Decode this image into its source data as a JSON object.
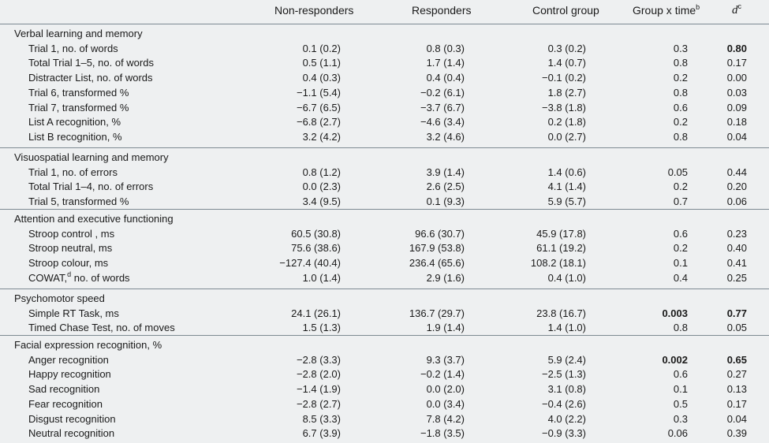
{
  "headers": {
    "c2": "Non-responders",
    "c3": "Responders",
    "c4": "Control group",
    "c5": "Group x time",
    "c5_sup": "b",
    "c6": "d",
    "c6_sup": "c"
  },
  "sections": [
    {
      "title": "Verbal learning and memory",
      "rows": [
        {
          "label": "Trial 1, no. of words",
          "c2": "0.1 (0.2)",
          "c3": "0.8 (0.3)",
          "c4": "0.3 (0.2)",
          "c5": "0.3",
          "c6": "0.80",
          "bold5": false,
          "bold6": true
        },
        {
          "label": "Total Trial 1–5, no. of words",
          "c2": "0.5 (1.1)",
          "c3": "1.7 (1.4)",
          "c4": "1.4 (0.7)",
          "c5": "0.8",
          "c6": "0.17",
          "bold5": false,
          "bold6": false
        },
        {
          "label": "Distracter List, no. of words",
          "c2": "0.4 (0.3)",
          "c3": "0.4 (0.4)",
          "c4": "−0.1 (0.2)",
          "c5": "0.2",
          "c6": "0.00",
          "bold5": false,
          "bold6": false
        },
        {
          "label": "Trial 6, transformed %",
          "c2": "−1.1 (5.4)",
          "c3": "−0.2 (6.1)",
          "c4": "1.8 (2.7)",
          "c5": "0.8",
          "c6": "0.03",
          "bold5": false,
          "bold6": false
        },
        {
          "label": "Trial 7, transformed %",
          "c2": "−6.7 (6.5)",
          "c3": "−3.7 (6.7)",
          "c4": "−3.8 (1.8)",
          "c5": "0.6",
          "c6": "0.09",
          "bold5": false,
          "bold6": false
        },
        {
          "label": "List A recognition, %",
          "c2": "−6.8 (2.7)",
          "c3": "−4.6 (3.4)",
          "c4": "0.2 (1.8)",
          "c5": "0.2",
          "c6": "0.18",
          "bold5": false,
          "bold6": false
        },
        {
          "label": "List B recognition, %",
          "c2": "3.2 (4.2)",
          "c3": "3.2 (4.6)",
          "c4": "0.0 (2.7)",
          "c5": "0.8",
          "c6": "0.04",
          "bold5": false,
          "bold6": false
        }
      ]
    },
    {
      "title": "Visuospatial learning and memory",
      "rows": [
        {
          "label": "Trial 1, no. of errors",
          "c2": "0.8 (1.2)",
          "c3": "3.9 (1.4)",
          "c4": "1.4 (0.6)",
          "c5": "0.05",
          "c6": "0.44",
          "bold5": false,
          "bold6": false
        },
        {
          "label": "Total Trial 1–4, no. of errors",
          "c2": "0.0 (2.3)",
          "c3": "2.6 (2.5)",
          "c4": "4.1 (1.4)",
          "c5": "0.2",
          "c6": "0.20",
          "bold5": false,
          "bold6": false
        },
        {
          "label": "Trial 5, transformed %",
          "c2": "3.4 (9.5)",
          "c3": "0.1 (9.3)",
          "c4": "5.9 (5.7)",
          "c5": "0.7",
          "c6": "0.06",
          "bold5": false,
          "bold6": false
        }
      ]
    },
    {
      "title": "Attention and executive functioning",
      "rows": [
        {
          "label": "Stroop control , ms",
          "c2": "60.5 (30.8)",
          "c3": "96.6 (30.7)",
          "c4": "45.9 (17.8)",
          "c5": "0.6",
          "c6": "0.23",
          "bold5": false,
          "bold6": false
        },
        {
          "label": "Stroop neutral, ms",
          "c2": "75.6 (38.6)",
          "c3": "167.9 (53.8)",
          "c4": "61.1 (19.2)",
          "c5": "0.2",
          "c6": "0.40",
          "bold5": false,
          "bold6": false
        },
        {
          "label": "Stroop colour, ms",
          "c2": "−127.4 (40.4)",
          "c3": "236.4 (65.6)",
          "c4": "108.2 (18.1)",
          "c5": "0.1",
          "c6": "0.41",
          "bold5": false,
          "bold6": false
        },
        {
          "label": "COWAT,",
          "label_sup": "d",
          "label_rest": " no. of words",
          "c2": "1.0 (1.4)",
          "c3": "2.9 (1.6)",
          "c4": "0.4 (1.0)",
          "c5": "0.4",
          "c6": "0.25",
          "bold5": false,
          "bold6": false
        }
      ]
    },
    {
      "title": "Psychomotor speed",
      "rows": [
        {
          "label": "Simple RT Task, ms",
          "c2": "24.1 (26.1)",
          "c3": "136.7 (29.7)",
          "c4": "23.8 (16.7)",
          "c5": "0.003",
          "c6": "0.77",
          "bold5": true,
          "bold6": true
        },
        {
          "label": "Timed Chase Test, no. of moves",
          "c2": "1.5 (1.3)",
          "c3": "1.9 (1.4)",
          "c4": "1.4 (1.0)",
          "c5": "0.8",
          "c6": "0.05",
          "bold5": false,
          "bold6": false
        }
      ]
    },
    {
      "title": "Facial expression recognition, %",
      "rows": [
        {
          "label": "Anger recognition",
          "c2": "−2.8 (3.3)",
          "c3": "9.3 (3.7)",
          "c4": "5.9 (2.4)",
          "c5": "0.002",
          "c6": "0.65",
          "bold5": true,
          "bold6": true
        },
        {
          "label": "Happy recognition",
          "c2": "−2.8 (2.0)",
          "c3": "−0.2 (1.4)",
          "c4": "−2.5 (1.3)",
          "c5": "0.6",
          "c6": "0.27",
          "bold5": false,
          "bold6": false
        },
        {
          "label": "Sad recognition",
          "c2": "−1.4 (1.9)",
          "c3": "0.0 (2.0)",
          "c4": "3.1 (0.8)",
          "c5": "0.1",
          "c6": "0.13",
          "bold5": false,
          "bold6": false
        },
        {
          "label": "Fear recognition",
          "c2": "−2.8 (2.7)",
          "c3": "0.0 (3.4)",
          "c4": "−0.4 (2.6)",
          "c5": "0.5",
          "c6": "0.17",
          "bold5": false,
          "bold6": false
        },
        {
          "label": "Disgust recognition",
          "c2": "8.5 (3.3)",
          "c3": "7.8 (4.2)",
          "c4": "4.0 (2.2)",
          "c5": "0.3",
          "c6": "0.04",
          "bold5": false,
          "bold6": false
        },
        {
          "label": "Neutral recognition",
          "c2": "6.7 (3.9)",
          "c3": "−1.8 (3.5)",
          "c4": "−0.9 (3.3)",
          "c5": "0.06",
          "c6": "0.39",
          "bold5": false,
          "bold6": false
        }
      ]
    }
  ]
}
